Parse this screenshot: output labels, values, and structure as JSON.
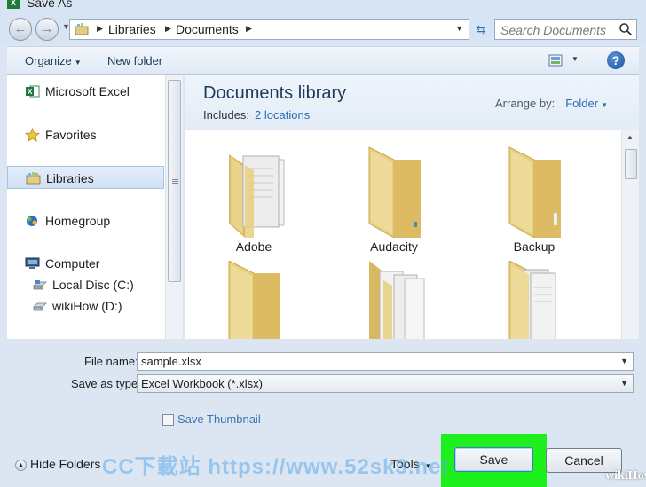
{
  "window": {
    "title": "Save As",
    "app_icon_letter": "X"
  },
  "address": {
    "crumbs": [
      "Libraries",
      "Documents"
    ],
    "search_placeholder": "Search Documents"
  },
  "toolbar": {
    "organize_label": "Organize",
    "new_folder_label": "New folder",
    "help_label": "?"
  },
  "nav": {
    "items": [
      {
        "label": "Microsoft Excel",
        "icon": "excel-icon"
      },
      {
        "label": "Favorites",
        "icon": "star-icon"
      },
      {
        "label": "Libraries",
        "icon": "libraries-icon",
        "selected": true
      },
      {
        "label": "Homegroup",
        "icon": "homegroup-icon"
      },
      {
        "label": "Computer",
        "icon": "computer-icon"
      },
      {
        "label": "Local Disc (C:)",
        "icon": "drive-icon"
      },
      {
        "label": "wikiHow (D:)",
        "icon": "drive-icon"
      }
    ]
  },
  "content": {
    "library_title": "Documents library",
    "includes_label": "Includes:",
    "includes_link": "2 locations",
    "arrange_label": "Arrange by:",
    "arrange_value": "Folder",
    "folders": [
      {
        "name": "Adobe",
        "style": "papers"
      },
      {
        "name": "Audacity",
        "style": "plain"
      },
      {
        "name": "Backup",
        "style": "plain"
      },
      {
        "name": "",
        "style": "plain"
      },
      {
        "name": "",
        "style": "papers"
      },
      {
        "name": "",
        "style": "documents"
      }
    ]
  },
  "form": {
    "file_name_label": "File name:",
    "file_name_value": "sample.xlsx",
    "save_type_label": "Save as type:",
    "save_type_value": "Excel Workbook (*.xlsx)",
    "thumbnail_label": "Save Thumbnail",
    "hide_folders_label": "Hide Folders",
    "tools_label": "Tools",
    "save_label": "Save",
    "cancel_label": "Cancel"
  },
  "watermarks": {
    "site_text": "CC下載站 https://www.52sk3.net",
    "brand_text": "wikiHow"
  },
  "colors": {
    "highlight": "#1ef01e",
    "link": "#2a6cb5",
    "folder": "#e8cf7e"
  }
}
